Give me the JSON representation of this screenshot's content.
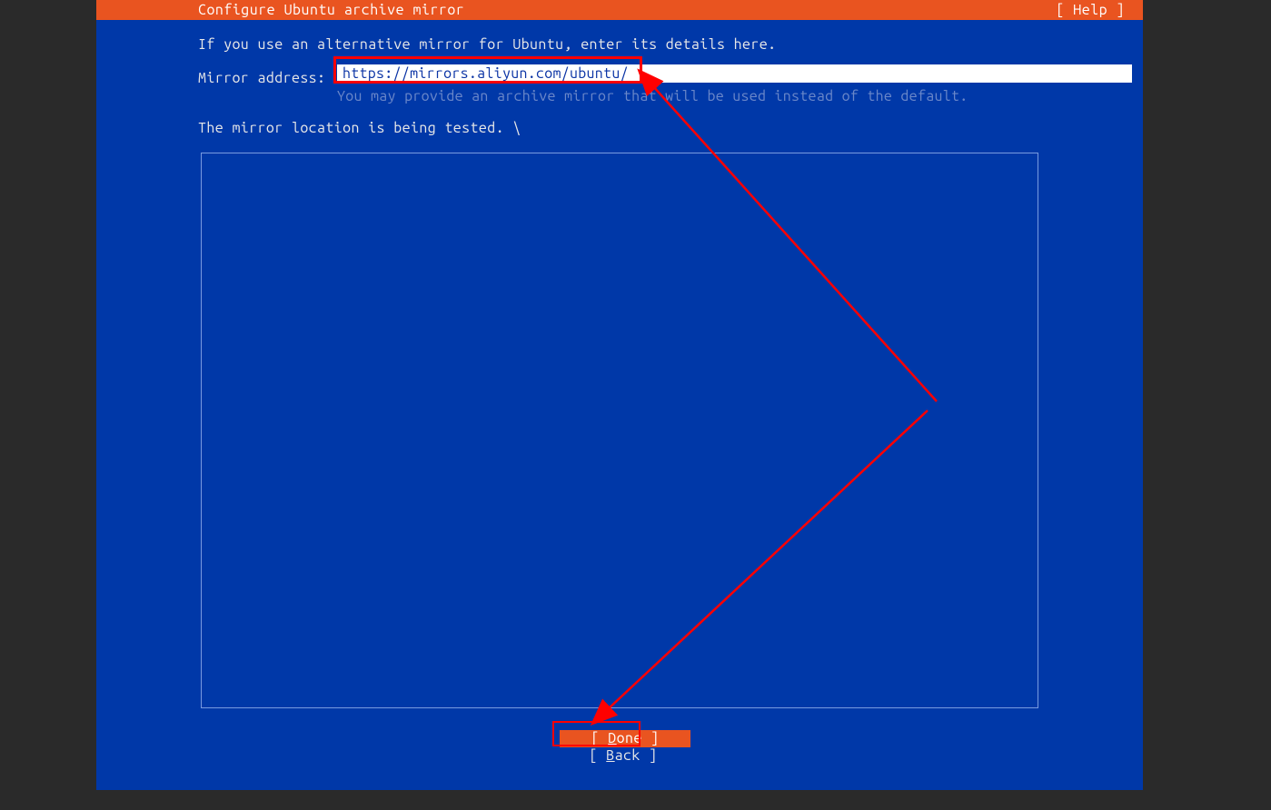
{
  "header": {
    "title": "Configure Ubuntu archive mirror",
    "help": "[ Help ]"
  },
  "main": {
    "instruction": "If you use an alternative mirror for Ubuntu, enter its details here.",
    "mirror_label": "Mirror address:",
    "mirror_value": "https://mirrors.aliyun.com/ubuntu/",
    "mirror_hint": "You may provide an archive mirror that will be used instead of the default.",
    "testing_line": "The mirror location is being tested. \\"
  },
  "buttons": {
    "done_pre": "[ ",
    "done_key": "D",
    "done_rest": "one       ]",
    "back_pre": "[ ",
    "back_key": "B",
    "back_rest": "ack       ]"
  }
}
